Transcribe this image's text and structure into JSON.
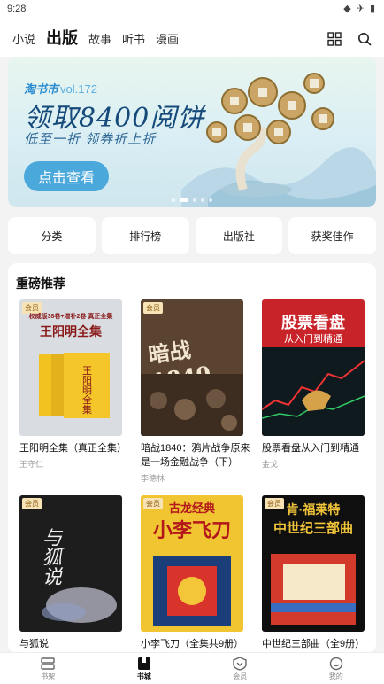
{
  "status_bar": {
    "time": "9:28"
  },
  "top_nav": {
    "tabs": [
      {
        "label": "小说",
        "active": false
      },
      {
        "label": "出版",
        "active": true
      },
      {
        "label": "故事",
        "active": false
      },
      {
        "label": "听书",
        "active": false
      },
      {
        "label": "漫画",
        "active": false
      }
    ]
  },
  "banner": {
    "brand": "淘书市",
    "vol": "vol.172",
    "headline": "领取8400阅饼",
    "sub": "低至一折 领券折上折",
    "cta": "点击查看"
  },
  "quick_links": [
    "分类",
    "排行榜",
    "出版社",
    "获奖佳作"
  ],
  "recommend": {
    "title": "重磅推荐",
    "badge": "会员",
    "books": [
      {
        "title": "王阳明全集（真正全集）",
        "author": "王守仁",
        "cover_text": "王阳明全集",
        "cover_top": "权威版38卷+增补2卷 真正全集",
        "cover_bg": "#d9dde2",
        "cover_fg": "#8a1a1a"
      },
      {
        "title": "暗战1840：鸦片战争原来是一场金融战争（下）",
        "author": "李德林",
        "cover_text": "暗战1840",
        "cover_top": "",
        "cover_bg": "#5b4331",
        "cover_fg": "#f3e6cf"
      },
      {
        "title": "股票看盘从入门到精通",
        "author": "金戈",
        "cover_text": "股票看盘",
        "cover_top": "从入门到精通",
        "cover_bg": "#c9232a",
        "cover_fg": "#ffffff"
      },
      {
        "title": "与狐说",
        "author": "",
        "cover_text": "与狐说",
        "cover_top": "",
        "cover_bg": "#1d1d1d",
        "cover_fg": "#eeeeee"
      },
      {
        "title": "小李飞刀（全集共9册）",
        "author": "",
        "cover_text": "小李飞刀",
        "cover_top": "古龙经典",
        "cover_bg": "#f0c531",
        "cover_fg": "#b3161b"
      },
      {
        "title": "中世纪三部曲（全9册）",
        "author": "",
        "cover_text": "中世纪三部曲",
        "cover_top": "肯·福莱特",
        "cover_bg": "#0f0f0f",
        "cover_fg": "#f3c63a"
      }
    ]
  },
  "bottom_bar": [
    {
      "label": "书架",
      "icon": "bookshelf-icon",
      "active": false
    },
    {
      "label": "书城",
      "icon": "bookstore-icon",
      "active": true
    },
    {
      "label": "会员",
      "icon": "member-icon",
      "active": false
    },
    {
      "label": "我的",
      "icon": "profile-icon",
      "active": false
    }
  ]
}
